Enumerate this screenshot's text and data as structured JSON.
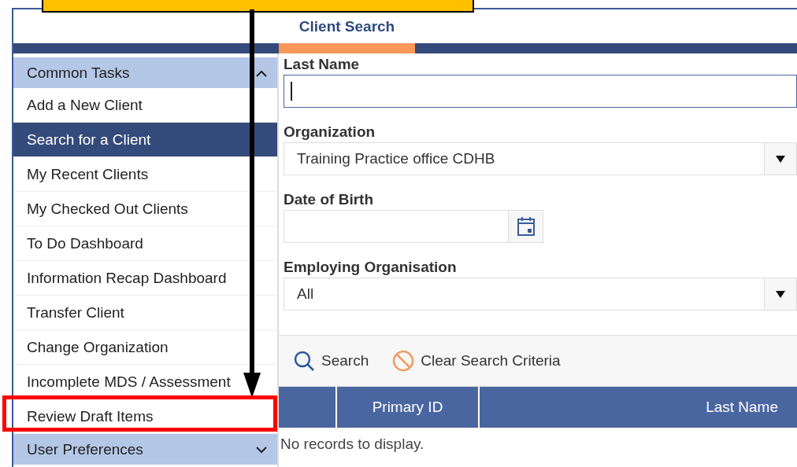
{
  "tabs": [
    {
      "label": "Client Search",
      "selected": true
    }
  ],
  "sidebar": {
    "sections": [
      {
        "title": "Common Tasks",
        "expanded": true,
        "items": [
          {
            "label": "Add a New Client",
            "selected": false,
            "highlighted": false
          },
          {
            "label": "Search for a Client",
            "selected": true,
            "highlighted": false
          },
          {
            "label": "My Recent Clients",
            "selected": false,
            "highlighted": false
          },
          {
            "label": "My Checked Out Clients",
            "selected": false,
            "highlighted": false
          },
          {
            "label": "To Do Dashboard",
            "selected": false,
            "highlighted": false
          },
          {
            "label": "Information Recap Dashboard",
            "selected": false,
            "highlighted": false
          },
          {
            "label": "Transfer Client",
            "selected": false,
            "highlighted": false
          },
          {
            "label": "Change Organization",
            "selected": false,
            "highlighted": false
          },
          {
            "label": "Incomplete MDS / Assessment",
            "selected": false,
            "highlighted": false
          },
          {
            "label": "Review Draft Items",
            "selected": false,
            "highlighted": true
          }
        ]
      },
      {
        "title": "User Preferences",
        "expanded": false
      }
    ]
  },
  "form": {
    "fields": [
      {
        "kind": "text",
        "label": "Last Name",
        "focused": true
      },
      {
        "kind": "select",
        "label": "Organization",
        "value": "Training Practice office CDHB"
      },
      {
        "kind": "date",
        "label": "Date of Birth"
      },
      {
        "kind": "select",
        "label": "Employing Organisation",
        "value": "All"
      }
    ]
  },
  "toolbar": [
    {
      "kind": "search",
      "label": "Search"
    },
    {
      "kind": "clear",
      "label": "Clear Search Criteria"
    }
  ],
  "table": {
    "columns": [
      "Primary ID",
      "Last Name"
    ],
    "empty_message": "No records to display."
  }
}
